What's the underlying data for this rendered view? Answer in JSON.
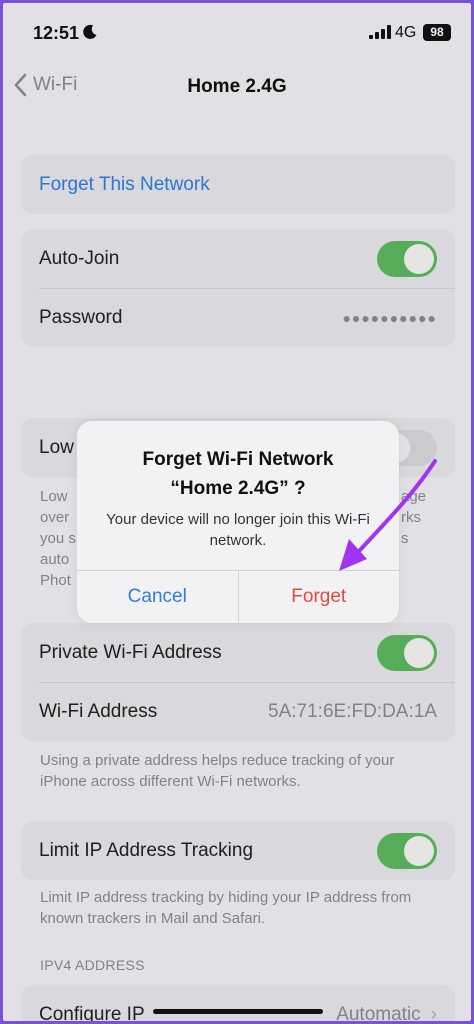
{
  "status_bar": {
    "time": "12:51",
    "network": "4G",
    "battery": "98"
  },
  "nav": {
    "back_label": "Wi-Fi",
    "title": "Home 2.4G"
  },
  "forget_link": "Forget This Network",
  "auto_join": {
    "label": "Auto-Join",
    "on": true
  },
  "password": {
    "label": "Password",
    "value": "●●●●●●●●●●"
  },
  "low_data": {
    "label_visible": "Low",
    "footnote_lines": [
      "Low",
      "over",
      "you s",
      "auto",
      "Phot"
    ],
    "footnote_right": [
      "age",
      "rks",
      "",
      "s",
      ""
    ]
  },
  "private_address": {
    "label": "Private Wi-Fi Address",
    "on": true
  },
  "wifi_address": {
    "label": "Wi-Fi Address",
    "value": "5A:71:6E:FD:DA:1A"
  },
  "private_footnote": "Using a private address helps reduce tracking of your iPhone across different Wi-Fi networks.",
  "limit_ip": {
    "label": "Limit IP Address Tracking",
    "on": true
  },
  "limit_footnote": "Limit IP address tracking by hiding your IP address from known trackers in Mail and Safari.",
  "ipv4_header": "IPV4 ADDRESS",
  "configure_ip": {
    "label": "Configure IP",
    "value": "Automatic"
  },
  "alert": {
    "title_line1": "Forget Wi-Fi Network",
    "title_line2": "“Home 2.4G” ?",
    "message": "Your device will no longer join this Wi-Fi network.",
    "cancel_label": "Cancel",
    "forget_label": "Forget"
  },
  "colors": {
    "accent_blue": "#2f7de0",
    "destructive_red": "#e04a3c",
    "toggle_green": "#5cb85f",
    "annotation_purple": "#a035f0"
  },
  "icons": [
    "moon-icon",
    "signal-icon",
    "battery-icon",
    "chevron-left-icon",
    "chevron-right-icon",
    "annotation-arrow-icon"
  ]
}
